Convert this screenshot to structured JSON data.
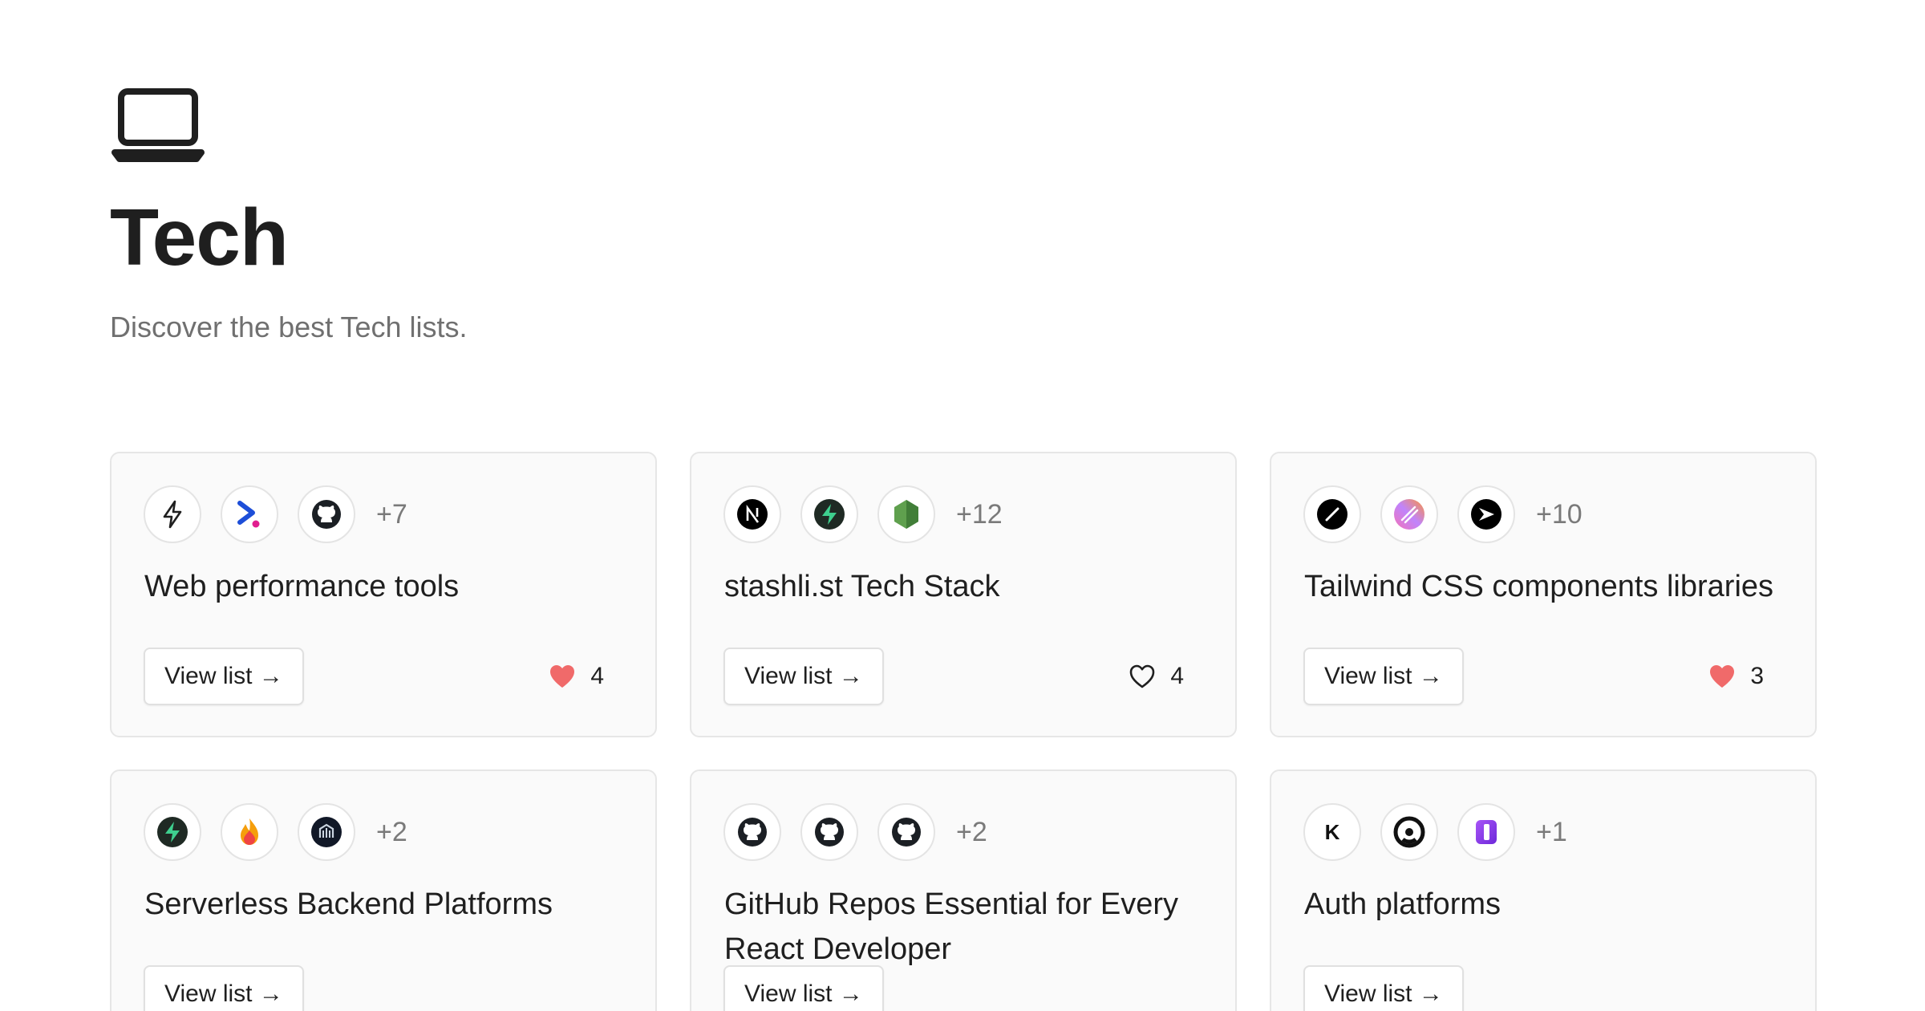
{
  "header": {
    "icon": "laptop-icon",
    "title": "Tech",
    "subtitle": "Discover the best Tech lists."
  },
  "colors": {
    "heart_filled": "#f06a6a",
    "card_bg": "#fafafa",
    "card_border": "#e6e6e6",
    "muted_text": "#707070"
  },
  "cards": [
    {
      "title": "Web performance tools",
      "icons": [
        "lightning-icon",
        "terminal-chevron-icon",
        "github-icon"
      ],
      "more": "+7",
      "button": "View list →",
      "likes": "4",
      "liked": true
    },
    {
      "title": "stashli.st Tech Stack",
      "icons": [
        "nextjs-icon",
        "supabase-icon",
        "nodejs-icon"
      ],
      "more": "+12",
      "button": "View list →",
      "likes": "4",
      "liked": false
    },
    {
      "title": "Tailwind CSS components libraries",
      "icons": [
        "slash-circle-icon",
        "gradient-slash-icon",
        "play-circle-icon"
      ],
      "more": "+10",
      "button": "View list →",
      "likes": "3",
      "liked": true
    },
    {
      "title": "Serverless Backend Platforms",
      "icons": [
        "supabase-icon",
        "firebase-icon",
        "appwrite-icon"
      ],
      "more": "+2",
      "button": "View list →",
      "likes": "",
      "liked": false
    },
    {
      "title": "GitHub Repos Essential for Every React Developer",
      "icons": [
        "github-icon",
        "github-icon",
        "github-icon"
      ],
      "more": "+2",
      "button": "View list →",
      "likes": "",
      "liked": false
    },
    {
      "title": "Auth platforms",
      "icons": [
        "kinde-icon",
        "clerk-icon",
        "purple-logo-icon"
      ],
      "more": "+1",
      "button": "View list →",
      "likes": "",
      "liked": false
    }
  ]
}
